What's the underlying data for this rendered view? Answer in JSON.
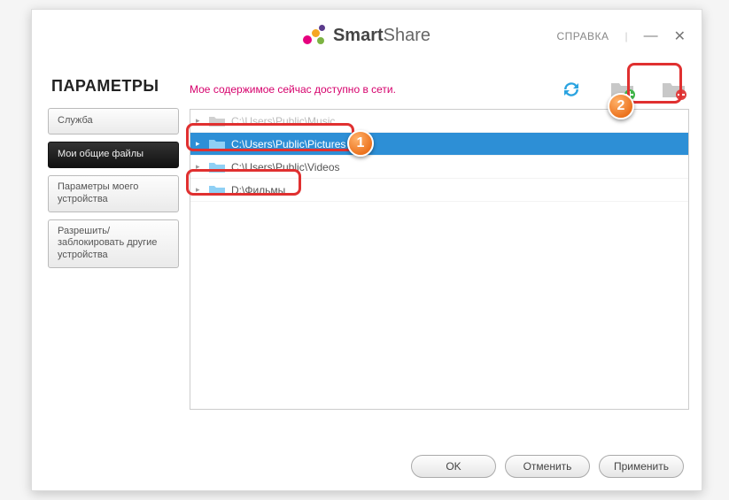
{
  "brand": {
    "bold": "Smart",
    "light": "Share"
  },
  "titlebar": {
    "help": "СПРАВКА"
  },
  "page_title": "ПАРАМЕТРЫ",
  "sidebar": {
    "items": [
      {
        "label": "Служба"
      },
      {
        "label": "Мои общие файлы"
      },
      {
        "label": "Параметры моего устройства"
      },
      {
        "label": "Разрешить/\nзаблокировать другие устройства"
      }
    ],
    "active_index": 1
  },
  "status_text": "Мое содержимое сейчас доступно в сети.",
  "folders": [
    {
      "path": "C:\\Users\\Public\\Music",
      "selected": false,
      "dimmed": true
    },
    {
      "path": "C:\\Users\\Public\\Pictures",
      "selected": true
    },
    {
      "path": "C:\\Users\\Public\\Videos",
      "selected": false
    },
    {
      "path": "D:\\Фильмы",
      "selected": false
    }
  ],
  "buttons": {
    "ok": "OK",
    "cancel": "Отменить",
    "apply": "Применить"
  },
  "icons": {
    "refresh": "refresh-icon",
    "add_folder": "add-folder-icon",
    "remove_folder": "remove-folder-icon"
  },
  "annotations": {
    "badge1": "1",
    "badge2": "2"
  },
  "colors": {
    "accent": "#d6006c",
    "select": "#2d8fd6",
    "highlight": "#e03030"
  }
}
